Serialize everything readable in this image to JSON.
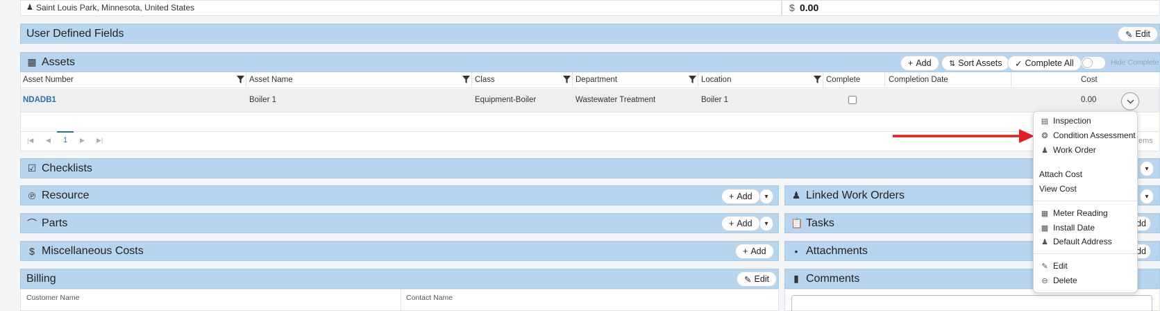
{
  "address": {
    "text": "Saint Louis Park, Minnesota, United States"
  },
  "total": {
    "currency": "$",
    "value": "0.00"
  },
  "udf": {
    "title": "User Defined Fields",
    "edit_label": "Edit"
  },
  "assets": {
    "title": "Assets",
    "add_label": "Add",
    "sort_label": "Sort Assets",
    "complete_all_label": "Complete All",
    "hide_complete_label": "Hide Complete",
    "columns": [
      "Asset Number",
      "Asset Name",
      "Class",
      "Department",
      "Location",
      "Complete",
      "Completion Date",
      "Cost"
    ],
    "row": {
      "asset_number": "NDADB1",
      "asset_name": "Boiler 1",
      "class": "Equipment-Boiler",
      "department": "Wastewater Treatment",
      "location": "Boiler 1",
      "complete": false,
      "completion_date": "",
      "cost": "0.00"
    },
    "pager": {
      "current_page": "1",
      "items_text": "ems"
    }
  },
  "sections": {
    "checklists": "Checklists",
    "resource": "Resource",
    "linked_work_orders": "Linked Work Orders",
    "parts": "Parts",
    "tasks": "Tasks",
    "misc_costs": "Miscellaneous Costs",
    "attachments": "Attachments",
    "billing": "Billing",
    "comments": "Comments",
    "add_label": "Add",
    "edit_label": "Edit",
    "tasks_add_partial": "dd"
  },
  "billing": {
    "customer_name_label": "Customer Name",
    "contact_name_label": "Contact Name"
  },
  "menu": {
    "inspection": "Inspection",
    "condition_assessment": "Condition Assessment",
    "work_order": "Work Order",
    "attach_cost": "Attach Cost",
    "view_cost": "View Cost",
    "meter_reading": "Meter Reading",
    "install_date": "Install Date",
    "default_address": "Default Address",
    "edit": "Edit",
    "delete": "Delete"
  },
  "colors": {
    "header_bar": "#b7d5ee",
    "link": "#2a6ebb",
    "arrow": "#e0201f"
  }
}
